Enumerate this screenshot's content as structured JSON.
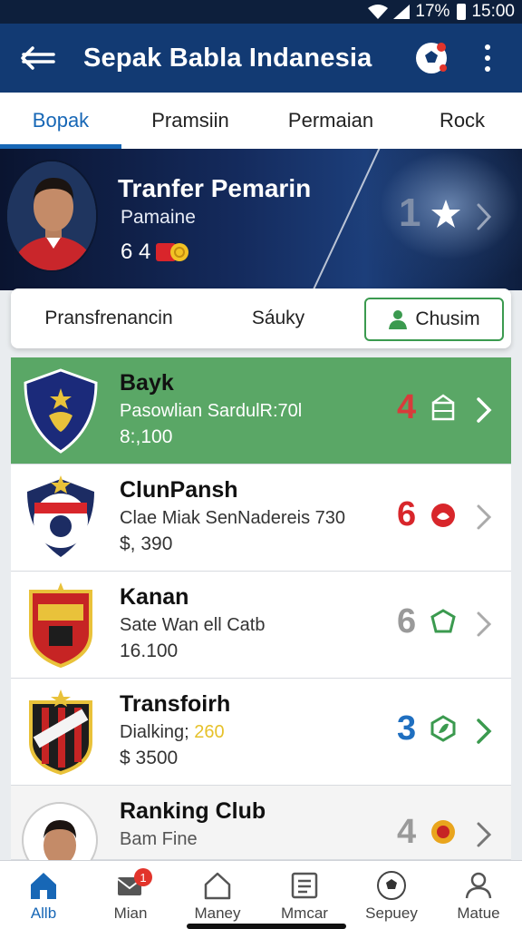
{
  "status": {
    "battery": "17%",
    "time": "15:00"
  },
  "app_bar": {
    "title": "Sepak Babla  Indanesia",
    "back_icon": "back-arrow-icon",
    "ball_icon": "soccer-ball-icon",
    "more_icon": "more-vertical-icon"
  },
  "tabs": [
    {
      "label": "Bopak",
      "active": true
    },
    {
      "label": "Pramsiin"
    },
    {
      "label": "Permaian"
    },
    {
      "label": "Rock"
    }
  ],
  "hero": {
    "title": "Tranfer Pemarin",
    "subtitle": "Pamaine",
    "stat": "6 4",
    "rank": "1",
    "star_icon": "star-icon"
  },
  "segment": [
    {
      "label": "Pransfrenancin"
    },
    {
      "label": "Sáuky"
    },
    {
      "label": "Chusim",
      "active": true
    }
  ],
  "clubs": [
    {
      "name": "Bayk",
      "desc": "Pasowlian SardulR:70l",
      "value": "8:,100",
      "rank": "4",
      "rank_color": "#d83b3b",
      "highlight": true
    },
    {
      "name": "ClunPansh",
      "desc": "Clae Miak SenNadereis 730",
      "value": "$, 390",
      "rank": "6",
      "rank_color": "#d8262b"
    },
    {
      "name": "Kanan",
      "desc": "Sate Wan ell Catb",
      "value": "16.100",
      "rank": "6",
      "rank_color": "#9a9a9a"
    },
    {
      "name": "Transfoirh",
      "desc_prefix": "Dialking; ",
      "desc_accent": "260",
      "value": "$ 3500",
      "rank": "3",
      "rank_color": "#1f6fc0"
    },
    {
      "name": "Ranking Club",
      "desc": "Bam Fine",
      "value": "",
      "rank": "4",
      "rank_color": "#9a9a9a"
    }
  ],
  "bottom_nav": [
    {
      "label": "Allb",
      "icon": "home-icon",
      "active": true
    },
    {
      "label": "Mian",
      "icon": "mail-icon",
      "badge": "1"
    },
    {
      "label": "Maney",
      "icon": "house-outline-icon"
    },
    {
      "label": "Mmcar",
      "icon": "list-card-icon"
    },
    {
      "label": "Sepuey",
      "icon": "soccer-ball-icon"
    },
    {
      "label": "Matue",
      "icon": "person-icon"
    }
  ],
  "colors": {
    "app_bar": "#123a73",
    "accent_blue": "#1767b6",
    "highlight_green": "#5aa766",
    "active_green_border": "#3b9a4f"
  }
}
